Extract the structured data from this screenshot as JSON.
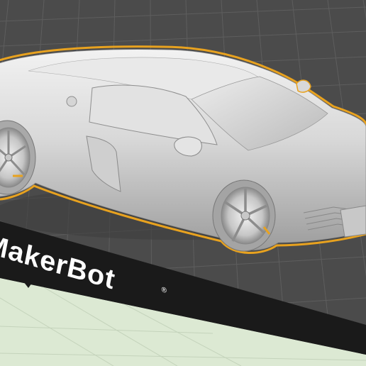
{
  "app": {
    "view": "3d-build-plate-viewport"
  },
  "build_plate": {
    "brand_label": "MakerBot",
    "registered_mark": "®",
    "plate_color": "#4b4b4b",
    "grid_color": "#5d5d5d",
    "front_strip_color": "#1a1a1a",
    "floor_color": "#dce9d3"
  },
  "model": {
    "selected": true,
    "highlight_color": "#e8a21f",
    "body_color": "#d9d9d9"
  }
}
